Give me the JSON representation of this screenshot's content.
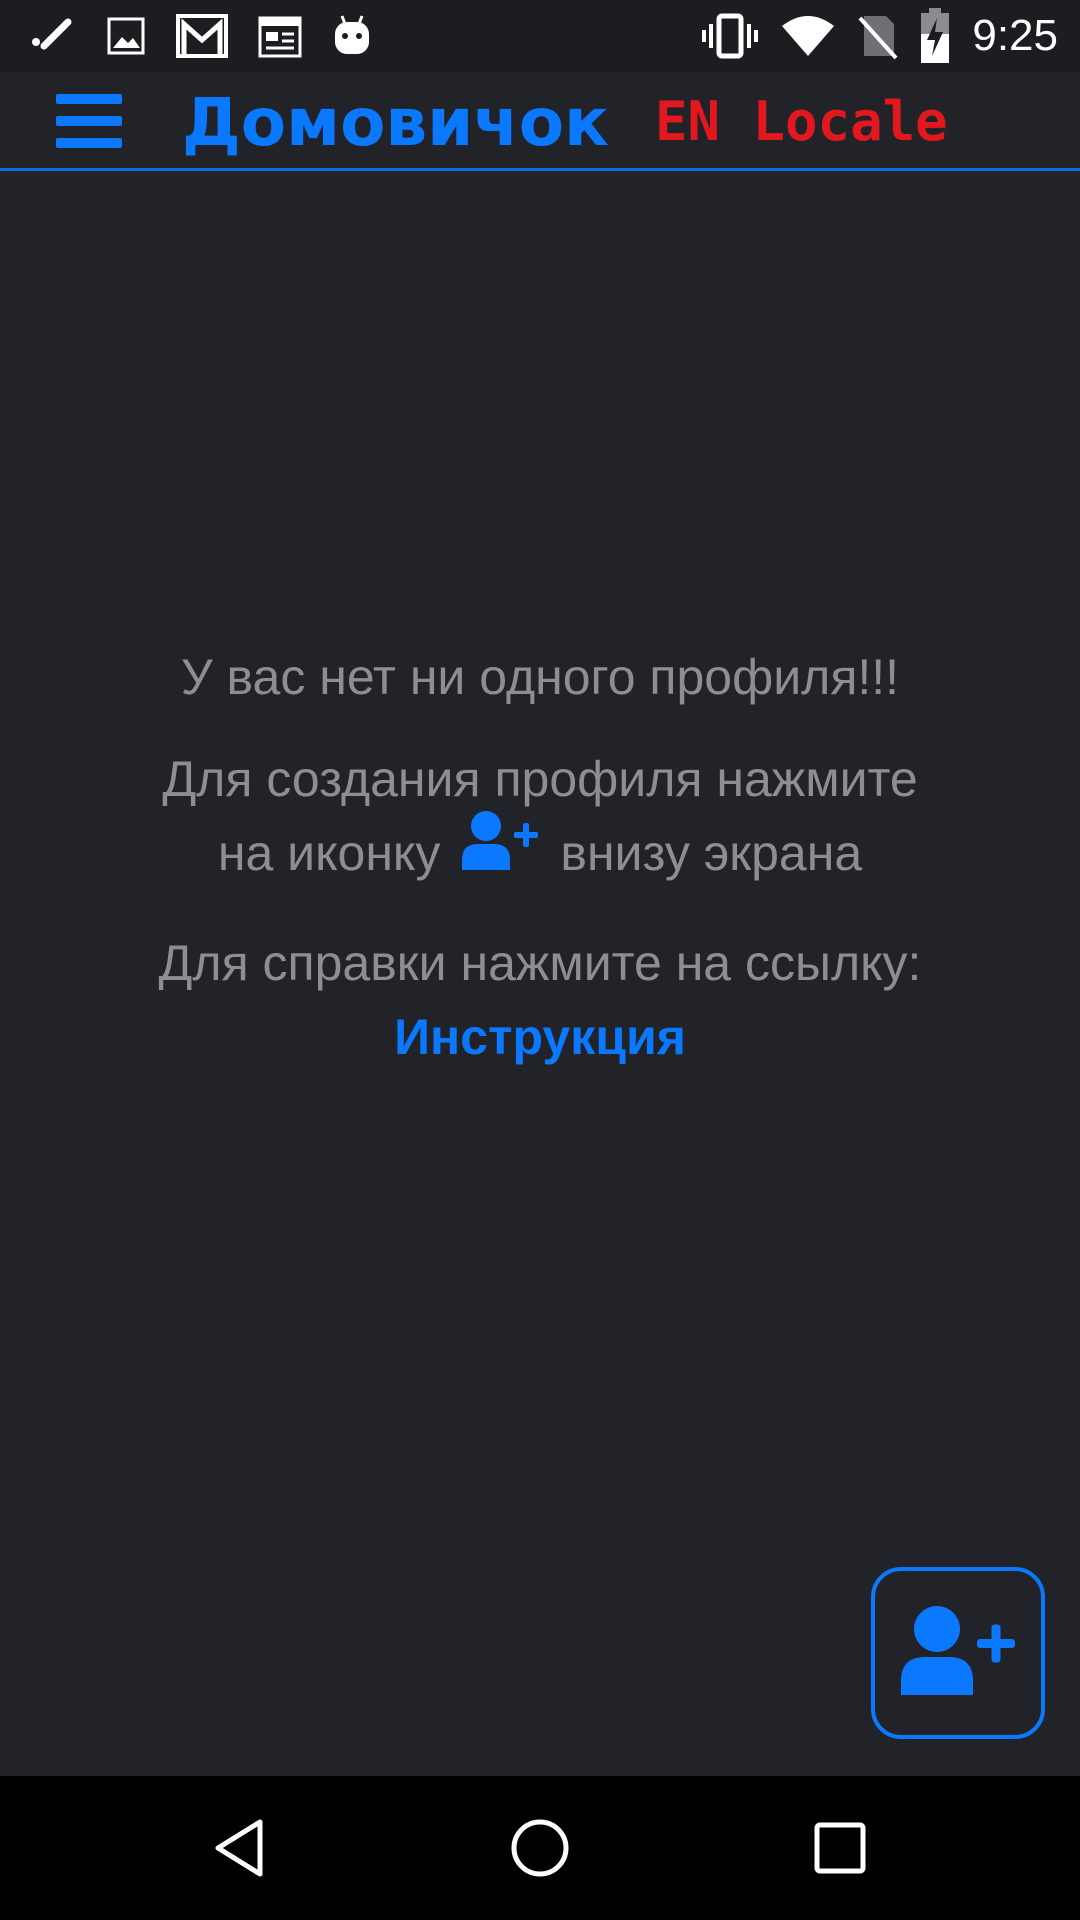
{
  "status_bar": {
    "time": "9:25",
    "left_icons": [
      "pen-icon",
      "image-icon",
      "gmail-icon",
      "calendar-icon",
      "android-icon"
    ],
    "right_icons": [
      "vibrate-icon",
      "wifi-icon",
      "no-sim-icon",
      "battery-charging-icon"
    ]
  },
  "app_bar": {
    "menu_icon": "hamburger-menu-icon",
    "title": "Домовичок",
    "locale_label": "EN Locale"
  },
  "empty_state": {
    "line1": "У вас нет ни одного профиля!!!",
    "line2": "Для создания профиля нажмите",
    "line3_prefix": "на иконку",
    "line3_icon": "add-user-icon",
    "line3_suffix": "внизу экрана",
    "line4": "Для справки нажмите на ссылку:",
    "link_label": "Инструкция"
  },
  "fab": {
    "icon": "add-user-icon"
  },
  "nav_bar": {
    "items": [
      "back-icon",
      "home-icon",
      "recents-icon"
    ]
  },
  "colors": {
    "background": "#212329",
    "accent": "#0a78ff",
    "locale": "#e3181f",
    "muted_text": "#8c8e92"
  }
}
